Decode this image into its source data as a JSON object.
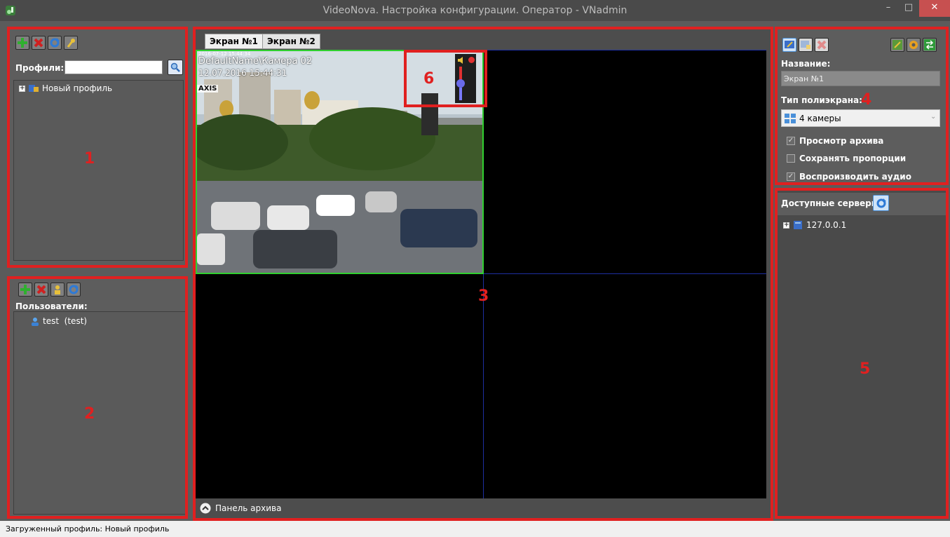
{
  "window": {
    "title": "VideoNova. Настройка конфигурации. Оператор - VNadmin",
    "minimize": "–",
    "maximize": "□",
    "close": "✕"
  },
  "profiles_panel": {
    "search_label": "Профили:",
    "search_value": "",
    "tree": [
      {
        "label": "Новый профиль"
      }
    ],
    "callout": "1"
  },
  "users_panel": {
    "label": "Пользователи:",
    "users": [
      {
        "label": "test  (test)"
      }
    ],
    "callout": "2"
  },
  "screen": {
    "tabs": [
      {
        "label": "Экран №1"
      },
      {
        "label": "Экран №2"
      }
    ],
    "camera": {
      "timestamp_top": "2016-07-12 15:44:34",
      "name_overlay": "DefaultName\\Камера 02",
      "datetime_overlay": "12.07.2016 15:44:31",
      "logo": "AXIS"
    },
    "archive_label": "Панель архива",
    "callout_grid": "3",
    "callout_controls": "6"
  },
  "properties": {
    "name_label": "Название:",
    "name_value": "Экран №1",
    "type_label": "Тип полиэкрана:",
    "type_value": "4 камеры",
    "checkboxes": [
      {
        "label": "Просмотр архива",
        "checked": true
      },
      {
        "label": "Сохранять пропорции",
        "checked": false
      },
      {
        "label": "Воспроизводить аудио",
        "checked": true
      }
    ],
    "callout": "4"
  },
  "servers": {
    "label": "Доступные серверы:",
    "items": [
      {
        "label": "127.0.0.1"
      }
    ],
    "callout": "5"
  },
  "statusbar": {
    "text": "Загруженный профиль: Новый профиль"
  },
  "colors": {
    "annotation_red": "#e02020",
    "selected_camera_border": "#30d030",
    "grid_line": "#1d2fa0"
  }
}
